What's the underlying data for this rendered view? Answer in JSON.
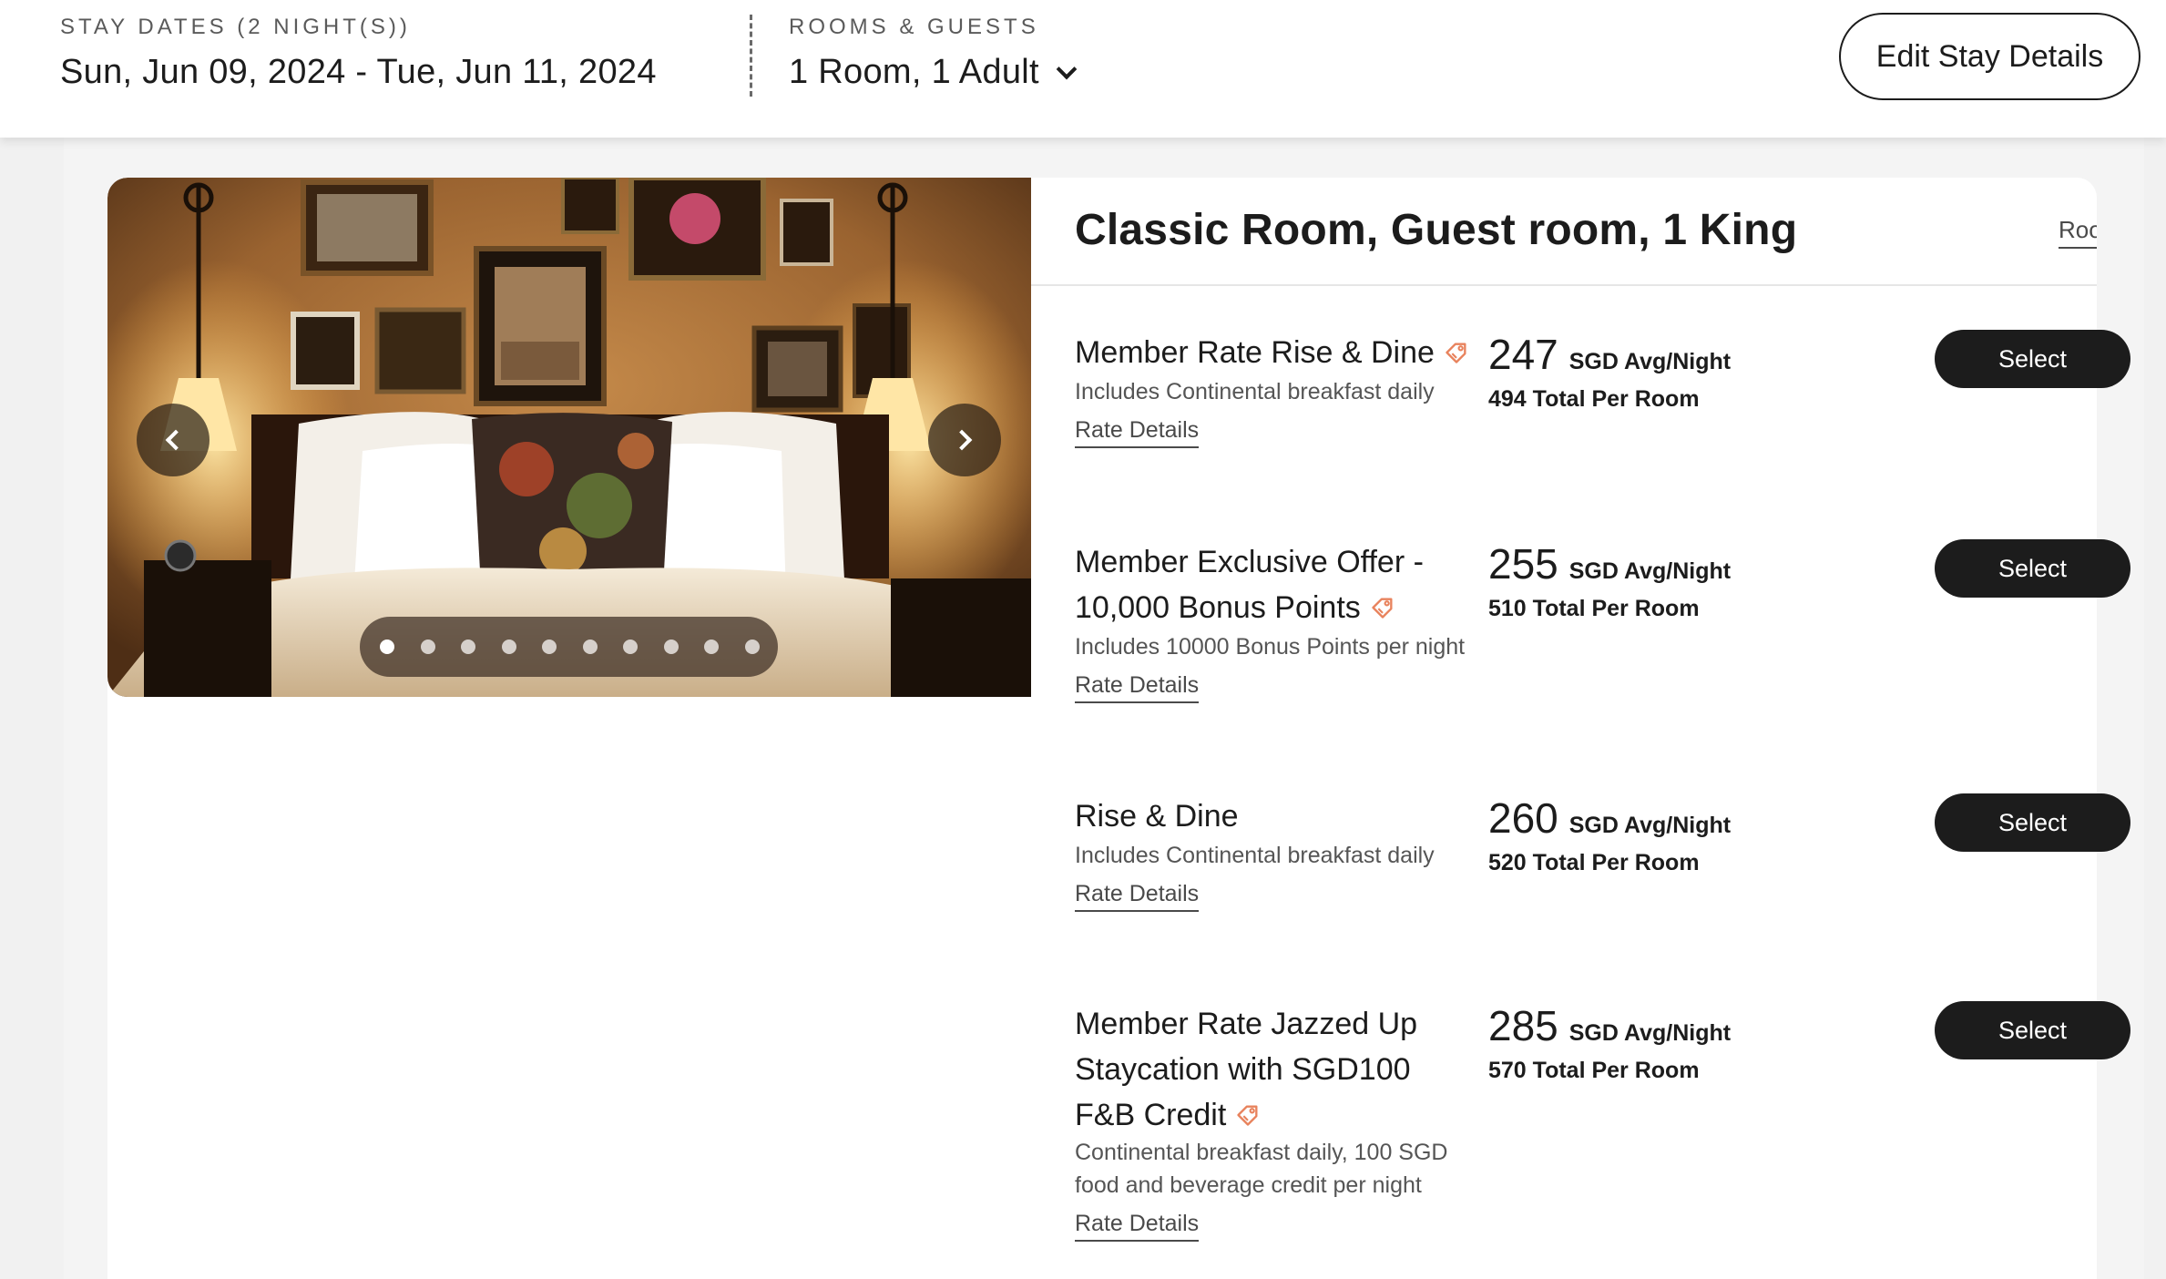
{
  "stay": {
    "dates_label": "STAY DATES (2 NIGHT(S))",
    "dates_value": "Sun, Jun 09, 2024 - Tue, Jun 11, 2024",
    "rooms_label": "ROOMS & GUESTS",
    "rooms_value": "1 Room, 1 Adult",
    "edit_label": "Edit Stay Details"
  },
  "room": {
    "title": "Classic Room, Guest room, 1 King",
    "details_link": "Room Details",
    "carousel": {
      "image_count": 10,
      "active_index": 0,
      "prev_icon": "chevron-left-icon",
      "next_icon": "chevron-right-icon"
    }
  },
  "rates": [
    {
      "name": "Member Rate Rise & Dine",
      "member_tag": true,
      "description": "Includes Continental breakfast daily",
      "link": "Rate Details",
      "price": "247",
      "price_unit": "SGD Avg/Night",
      "total": "494 Total Per Room",
      "select_label": "Select"
    },
    {
      "name": "Member Exclusive Offer - 10,000 Bonus Points",
      "member_tag": true,
      "description": "Includes 10000 Bonus Points per night",
      "link": "Rate Details",
      "price": "255",
      "price_unit": "SGD Avg/Night",
      "total": "510 Total Per Room",
      "select_label": "Select"
    },
    {
      "name": "Rise & Dine",
      "member_tag": false,
      "description": "Includes Continental breakfast daily",
      "link": "Rate Details",
      "price": "260",
      "price_unit": "SGD Avg/Night",
      "total": "520 Total Per Room",
      "select_label": "Select"
    },
    {
      "name": "Member Rate Jazzed Up Staycation with SGD100 F&B Credit",
      "member_tag": true,
      "description": "Continental breakfast daily, 100 SGD food and beverage credit per night",
      "link": "Rate Details",
      "price": "285",
      "price_unit": "SGD Avg/Night",
      "total": "570 Total Per Room",
      "select_label": "Select"
    }
  ],
  "colors": {
    "accent_tag": "#e8825c",
    "button_dark": "#1c1c1c",
    "page_bg": "#f1f1f1"
  }
}
